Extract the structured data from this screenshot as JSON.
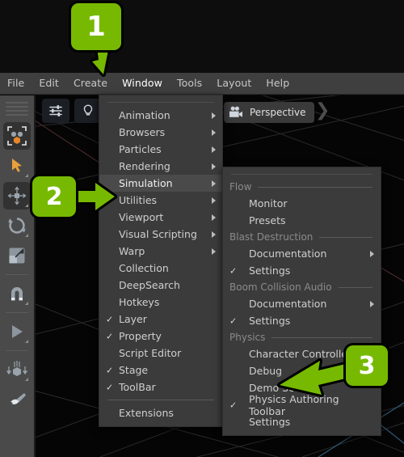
{
  "app": {
    "accent_color": "#76b900",
    "menu_bg": "#3b3b3b",
    "menubar_bg": "#3f3f3f",
    "toolbar_bg": "#4a4a4a",
    "viewport_bg": "#050505"
  },
  "menubar": {
    "items": [
      {
        "label": "File",
        "open": false
      },
      {
        "label": "Edit",
        "open": false
      },
      {
        "label": "Create",
        "open": false
      },
      {
        "label": "Window",
        "open": true
      },
      {
        "label": "Tools",
        "open": false
      },
      {
        "label": "Layout",
        "open": false
      },
      {
        "label": "Help",
        "open": false
      }
    ]
  },
  "toolbar": {
    "items": [
      {
        "name": "selection-mode-icon",
        "selected": true,
        "corner": false
      },
      {
        "name": "select-cursor-icon",
        "selected": false,
        "corner": true
      },
      {
        "name": "move-tool-icon",
        "selected": true,
        "corner": true
      },
      {
        "name": "rotate-tool-icon",
        "selected": false,
        "corner": true
      },
      {
        "name": "scale-tool-icon",
        "selected": false,
        "corner": false
      },
      {
        "name": "snap-magnet-icon",
        "selected": false,
        "corner": true
      },
      {
        "name": "play-icon",
        "selected": false,
        "corner": true
      },
      {
        "name": "physics-drop-icon",
        "selected": false,
        "corner": true
      },
      {
        "name": "paint-brush-icon",
        "selected": false,
        "corner": false
      }
    ]
  },
  "viewport": {
    "settings_icon": "sliders-icon",
    "lighting_icon": "lightbulb-icon",
    "camera_icon": "movie-camera-icon",
    "tab_label": "Perspective"
  },
  "window_menu": {
    "items": [
      {
        "label": "Animation",
        "submenu": true,
        "checked": false,
        "highlighted": false
      },
      {
        "label": "Browsers",
        "submenu": true,
        "checked": false,
        "highlighted": false
      },
      {
        "label": "Particles",
        "submenu": true,
        "checked": false,
        "highlighted": false
      },
      {
        "label": "Rendering",
        "submenu": true,
        "checked": false,
        "highlighted": false
      },
      {
        "label": "Simulation",
        "submenu": true,
        "checked": false,
        "highlighted": true
      },
      {
        "label": "Utilities",
        "submenu": true,
        "checked": false,
        "highlighted": false
      },
      {
        "label": "Viewport",
        "submenu": true,
        "checked": false,
        "highlighted": false
      },
      {
        "label": "Visual Scripting",
        "submenu": true,
        "checked": false,
        "highlighted": false
      },
      {
        "label": "Warp",
        "submenu": true,
        "checked": false,
        "highlighted": false
      },
      {
        "label": "Collection",
        "submenu": false,
        "checked": false,
        "highlighted": false
      },
      {
        "label": "DeepSearch",
        "submenu": false,
        "checked": false,
        "highlighted": false
      },
      {
        "label": "Hotkeys",
        "submenu": false,
        "checked": false,
        "highlighted": false
      },
      {
        "label": "Layer",
        "submenu": false,
        "checked": true,
        "highlighted": false
      },
      {
        "label": "Property",
        "submenu": false,
        "checked": true,
        "highlighted": false
      },
      {
        "label": "Script Editor",
        "submenu": false,
        "checked": false,
        "highlighted": false
      },
      {
        "label": "Stage",
        "submenu": false,
        "checked": true,
        "highlighted": false
      },
      {
        "label": "ToolBar",
        "submenu": false,
        "checked": true,
        "highlighted": false
      }
    ],
    "footer_item": {
      "label": "Extensions",
      "submenu": false,
      "checked": false
    }
  },
  "simulation_submenu": {
    "groups": [
      {
        "header": "Flow",
        "items": [
          {
            "label": "Monitor",
            "submenu": false,
            "checked": false
          },
          {
            "label": "Presets",
            "submenu": false,
            "checked": false
          }
        ]
      },
      {
        "header": "Blast Destruction",
        "items": [
          {
            "label": "Documentation",
            "submenu": true,
            "checked": false
          },
          {
            "label": "Settings",
            "submenu": false,
            "checked": true
          }
        ]
      },
      {
        "header": "Boom Collision Audio",
        "items": [
          {
            "label": "Documentation",
            "submenu": true,
            "checked": false
          },
          {
            "label": "Settings",
            "submenu": false,
            "checked": true
          }
        ]
      },
      {
        "header": "Physics",
        "items": [
          {
            "label": "Character Controller",
            "submenu": false,
            "checked": false
          },
          {
            "label": "Debug",
            "submenu": false,
            "checked": false
          },
          {
            "label": "Demo Scenes",
            "submenu": false,
            "checked": false
          },
          {
            "label": "Physics Authoring Toolbar",
            "submenu": false,
            "checked": true
          },
          {
            "label": "Settings",
            "submenu": false,
            "checked": false
          }
        ]
      }
    ]
  },
  "callouts": [
    {
      "number": "1",
      "target": "Window menu in the menu bar"
    },
    {
      "number": "2",
      "target": "Simulation item in the Window menu"
    },
    {
      "number": "3",
      "target": "Demo Scenes item in the Simulation submenu"
    }
  ]
}
